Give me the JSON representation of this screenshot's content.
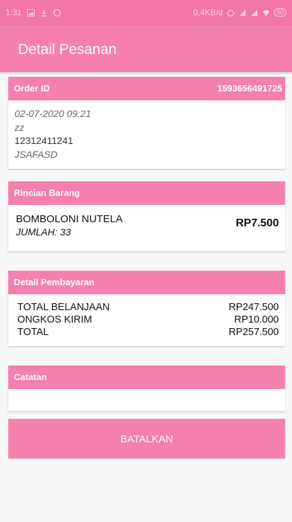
{
  "status_bar": {
    "time": "1:31",
    "network_speed": "0,4KB/d",
    "battery": "90",
    "icons": [
      "image-icon",
      "download-icon",
      "whatsapp-icon",
      "alarm-icon",
      "signal-icon",
      "signal-icon",
      "wifi-icon",
      "battery-icon"
    ]
  },
  "app_bar": {
    "title": "Detail Pesanan"
  },
  "order": {
    "header_label": "Order ID",
    "order_id": "1593656491725",
    "datetime": "02-07-2020 09:21",
    "name": "zz",
    "phone": "12312411241",
    "address": "JSAFASD"
  },
  "items": {
    "header_label": "Rincian Barang",
    "list": [
      {
        "name": "BOMBOLONI NUTELA",
        "quantity": "JUMLAH: 33",
        "price": "RP7.500"
      }
    ]
  },
  "payment": {
    "header_label": "Detail Pembayaran",
    "rows": [
      {
        "label": "TOTAL BELANJAAN",
        "value": "RP247.500"
      },
      {
        "label": "ONGKOS KIRIM",
        "value": "RP10.000"
      },
      {
        "label": "TOTAL",
        "value": "RP257.500"
      }
    ]
  },
  "notes": {
    "header_label": "Catatan",
    "value": ""
  },
  "actions": {
    "cancel_label": "BATALKAN"
  },
  "colors": {
    "primary": "#f580ad",
    "status_bar": "#f276a6",
    "background": "#f7f7f7"
  }
}
